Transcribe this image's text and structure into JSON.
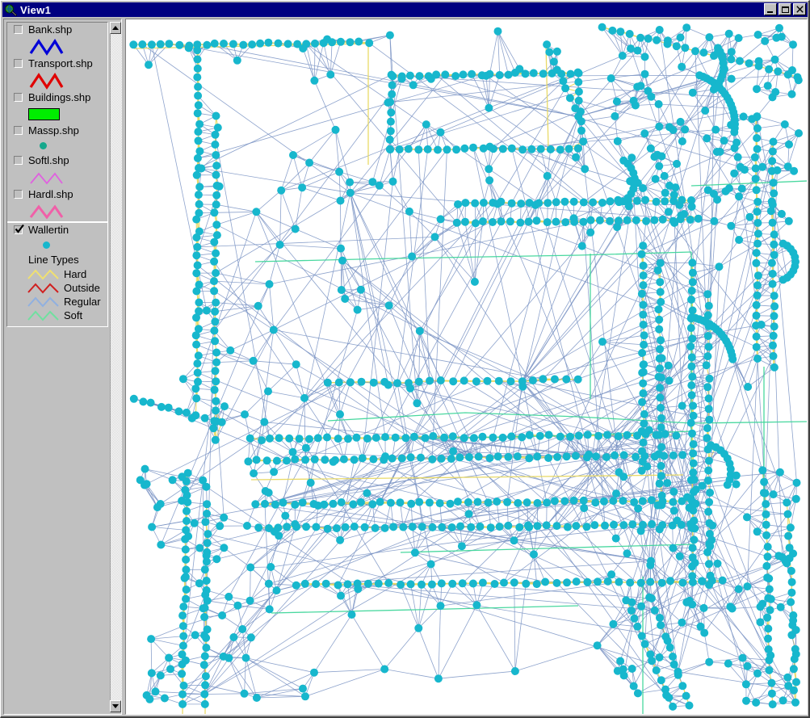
{
  "window": {
    "title": "View1",
    "icon": "magnifier-globe-icon",
    "buttons": {
      "minimize": "Minimize",
      "maximize": "Maximize",
      "close": "Close"
    }
  },
  "legend": {
    "groups": [
      {
        "themes": [
          {
            "name": "Bank.shp",
            "checked": false,
            "symbol": {
              "kind": "line",
              "color": "#0000d8",
              "width": 3
            }
          },
          {
            "name": "Transport.shp",
            "checked": false,
            "symbol": {
              "kind": "line",
              "color": "#e00000",
              "width": 3
            }
          },
          {
            "name": "Buildings.shp",
            "checked": false,
            "symbol": {
              "kind": "polygon",
              "color": "#00ee00",
              "outline": "#000000"
            }
          },
          {
            "name": "Massp.shp",
            "checked": false,
            "symbol": {
              "kind": "point",
              "color": "#16a88c"
            }
          },
          {
            "name": "Softl.shp",
            "checked": false,
            "symbol": {
              "kind": "line",
              "color": "#e060e0",
              "width": 2
            }
          },
          {
            "name": "Hardl.shp",
            "checked": false,
            "symbol": {
              "kind": "line",
              "color": "#f060a8",
              "width": 3
            }
          }
        ]
      },
      {
        "themes": [
          {
            "name": "Wallertin",
            "checked": true,
            "symbol": {
              "kind": "point",
              "color": "#17b7cd"
            },
            "subheading": "Line Types",
            "line_types": [
              {
                "label": "Hard",
                "color": "#f0e070"
              },
              {
                "label": "Outside",
                "color": "#d02020"
              },
              {
                "label": "Regular",
                "color": "#90b0e0"
              },
              {
                "label": "Soft",
                "color": "#70e0a0"
              }
            ]
          }
        ]
      }
    ],
    "scrollbar": {
      "up_arrow": "scroll-up",
      "down_arrow": "scroll-down"
    }
  },
  "map": {
    "description": "TIN triangulated irregular network of survey points",
    "background": "#ffffff",
    "vertex_color": "#17b7cd",
    "vertex_radius": 5,
    "edge_colors": {
      "regular": "#7a93c4",
      "hard": "#e8d860",
      "soft": "#3fd69a",
      "outside": "#d02020"
    },
    "seed": 20250411,
    "counts": {
      "vertices": 980,
      "triangulation_edges": 2300
    }
  }
}
